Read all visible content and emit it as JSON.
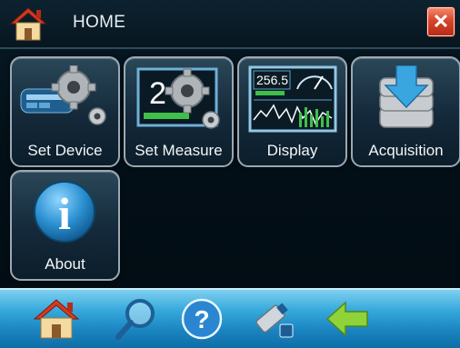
{
  "titlebar": {
    "title": "HOME",
    "close_label": "✕"
  },
  "tiles": [
    {
      "label": "Set Device",
      "icon": "gears-device-icon"
    },
    {
      "label": "Set Measure",
      "icon": "gears-measure-icon"
    },
    {
      "label": "Display",
      "icon": "display-chart-icon"
    },
    {
      "label": "Acquisition",
      "icon": "database-download-icon"
    },
    {
      "label": "About",
      "icon": "info-icon"
    }
  ],
  "set_measure_icon_text": "2",
  "display_icon_value": "256.5",
  "about_icon_glyph": "i",
  "bottombar": {
    "help_glyph": "?",
    "icons": [
      "home-icon",
      "search-icon",
      "help-icon",
      "usb-drive-icon",
      "back-arrow-icon"
    ]
  },
  "colors": {
    "accent": "#36a9dc",
    "close_red": "#d8452b",
    "back_arrow_green": "#8fd23a"
  }
}
